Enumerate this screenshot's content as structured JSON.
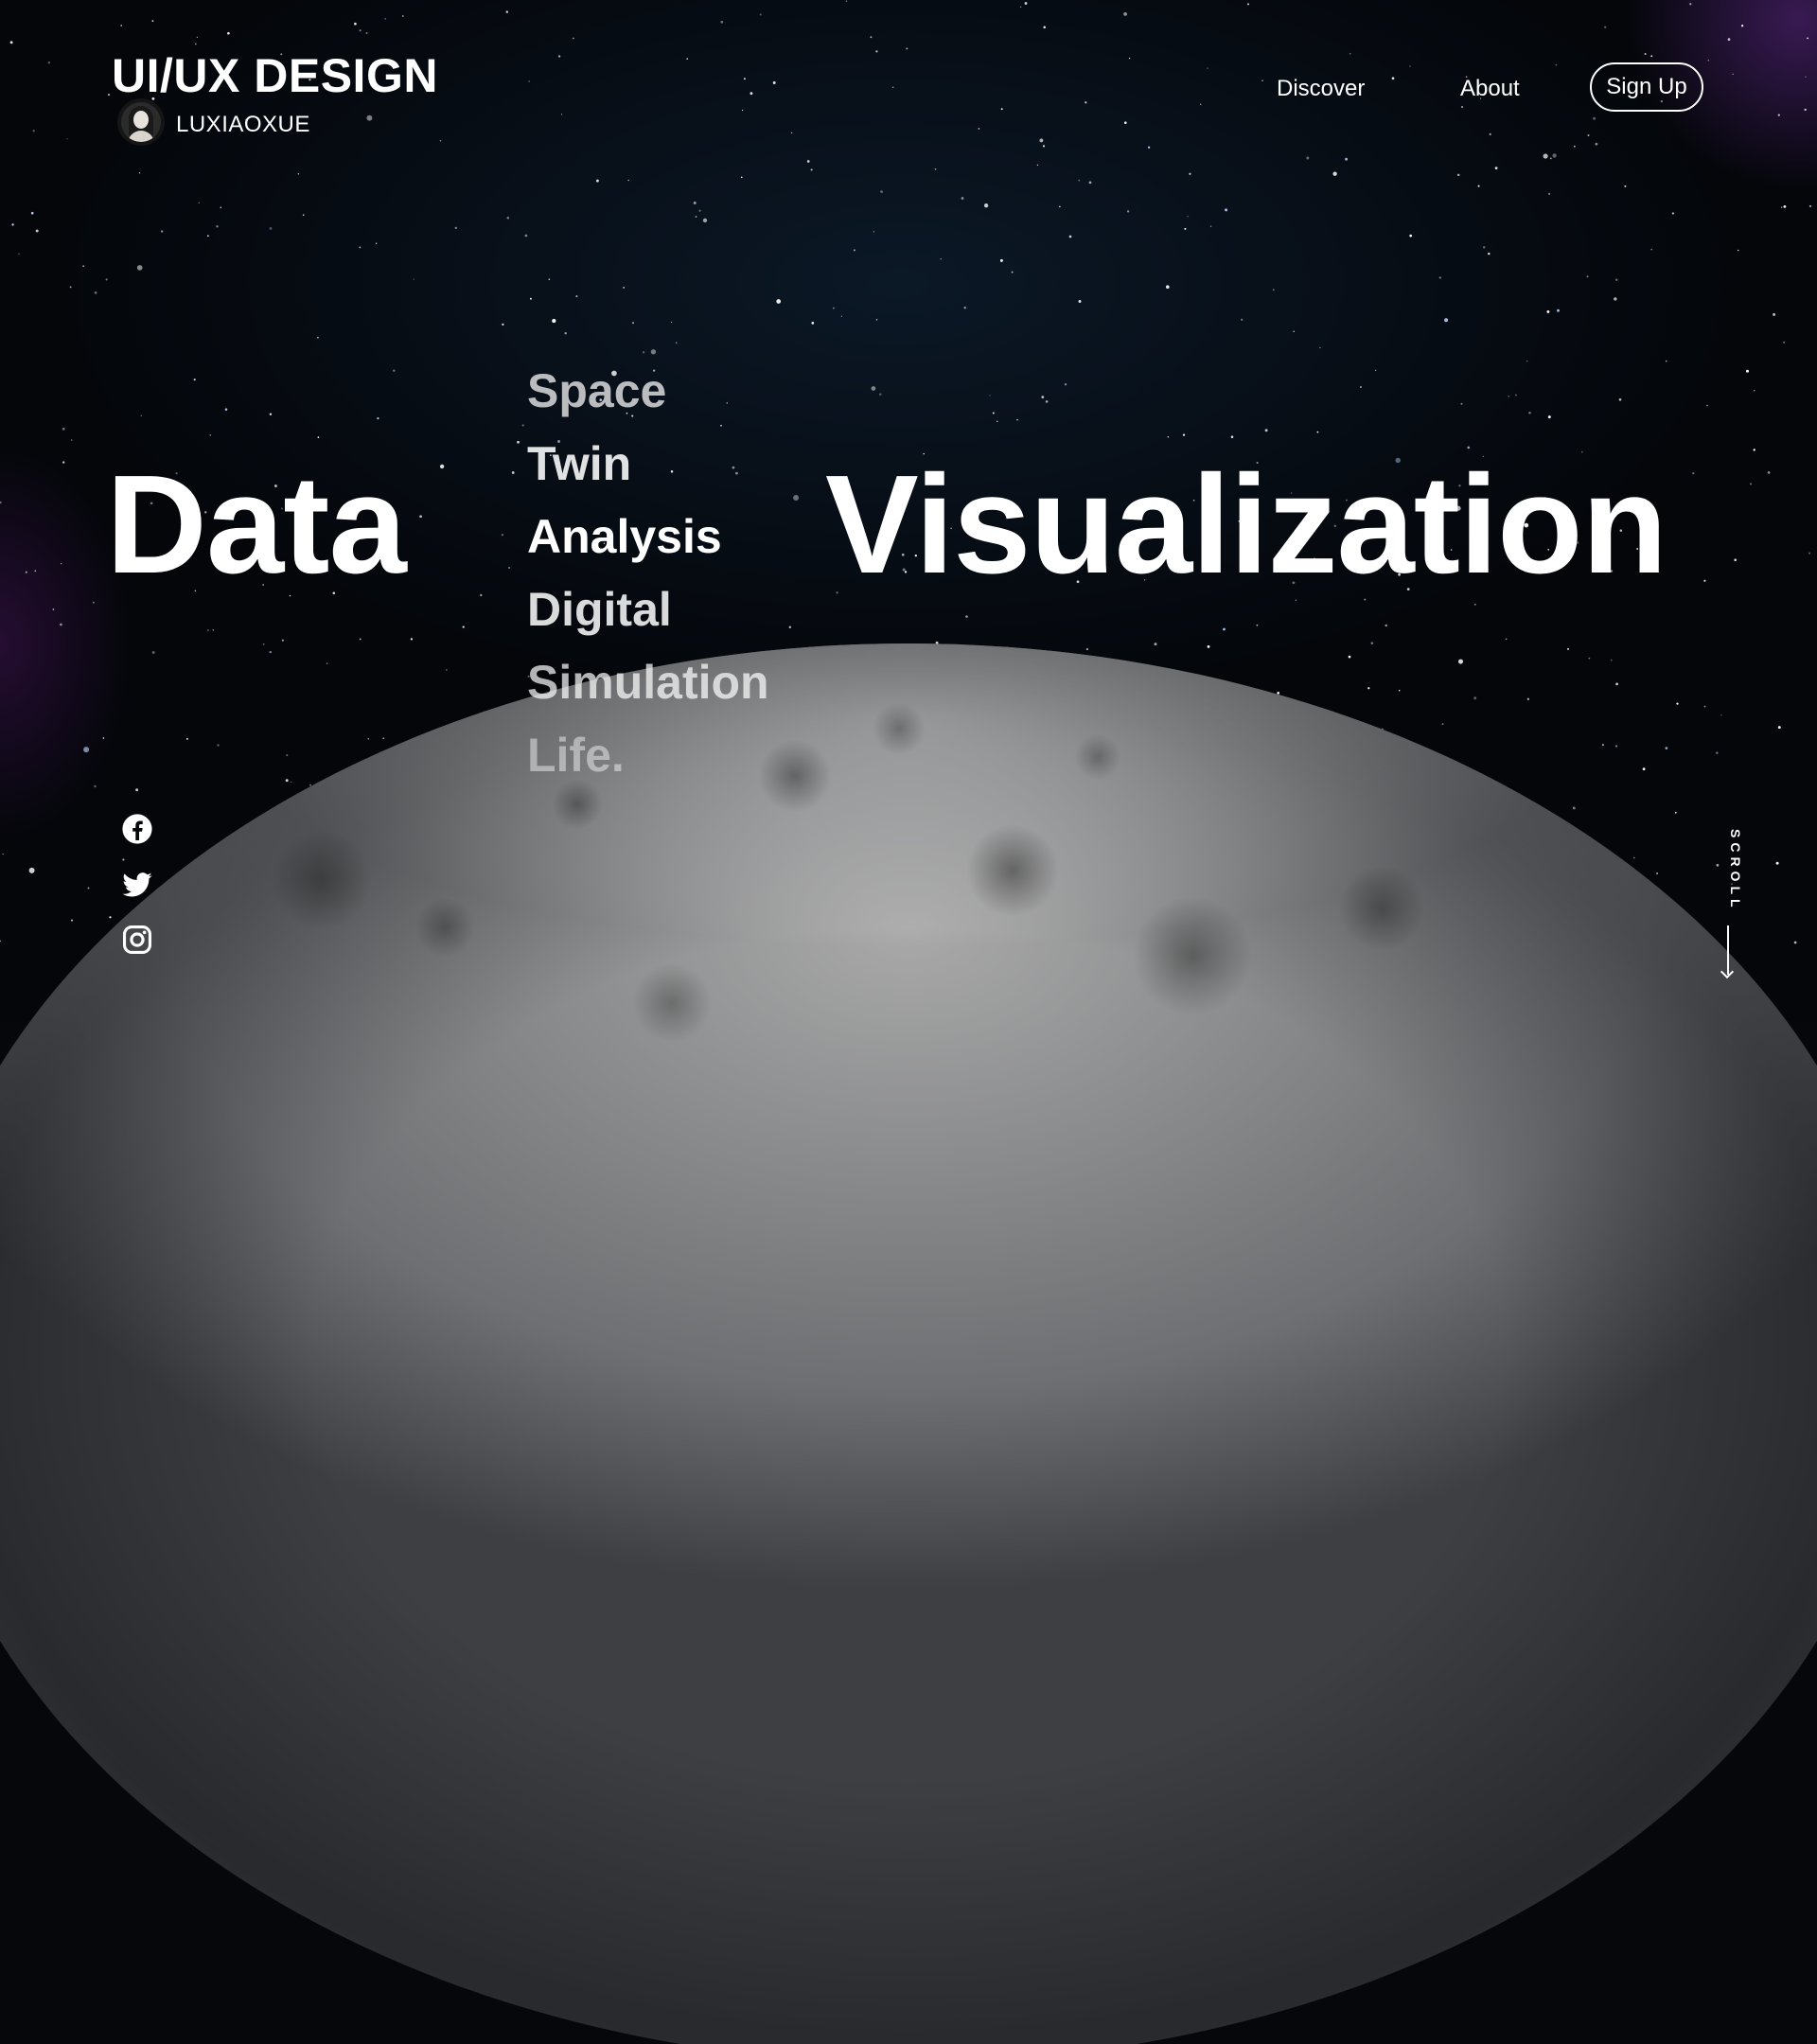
{
  "header": {
    "brand_title": "UI/UX DESIGN",
    "author_name": "LUXIAOXUE",
    "nav": {
      "discover": "Discover",
      "about": "About",
      "sign_up": "Sign Up"
    }
  },
  "hero": {
    "left_word": "Data",
    "right_word": "Visualization",
    "rotating_words": [
      "Space",
      "Twin",
      "Analysis",
      "Digital",
      "Simulation",
      "Life."
    ],
    "active_word": "Analysis"
  },
  "socials": {
    "icons": [
      "facebook-icon",
      "twitter-icon",
      "instagram-icon"
    ]
  },
  "scroll": {
    "label": "SCROLL"
  },
  "colors": {
    "background": "#05070b",
    "text": "#ffffff"
  }
}
